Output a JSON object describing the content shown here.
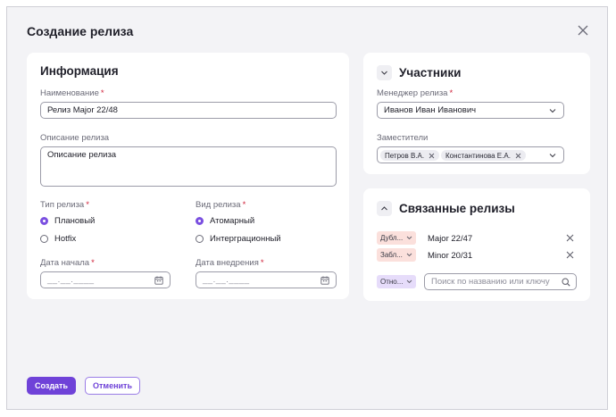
{
  "dialog": {
    "title": "Создание релиза"
  },
  "info": {
    "title": "Информация",
    "name_label": "Наименование",
    "name_value": "Релиз Major 22/48",
    "description_label": "Описание релиза",
    "description_value": "Описание релиза",
    "type_label": "Тип релиза",
    "type_options": [
      "Плановый",
      "Hotfix"
    ],
    "type_selected": "Плановый",
    "kind_label": "Вид релиза",
    "kind_options": [
      "Атомарный",
      "Интерграционный"
    ],
    "kind_selected": "Атомарный",
    "start_label": "Дата начала",
    "start_placeholder": "__.__.____",
    "deploy_label": "Дата внедрения",
    "deploy_placeholder": "__.__.____"
  },
  "participants": {
    "title": "Участники",
    "manager_label": "Менеджер релиза",
    "manager_value": "Иванов Иван Иванович",
    "deputies_label": "Заместители",
    "deputies": [
      "Петров В.А.",
      "Константинова Е.А."
    ]
  },
  "linked": {
    "title": "Связанные релизы",
    "items": [
      {
        "tag": "Дубл...",
        "name": "Major 22/47"
      },
      {
        "tag": "Забл...",
        "name": "Minor 20/31"
      }
    ],
    "new_tag": "Отно...",
    "search_placeholder": "Поиск по названию или ключу"
  },
  "actions": {
    "create_label": "Создать",
    "cancel_label": "Отменить"
  },
  "colors": {
    "accent": "#6f42d8",
    "required": "#d0243c",
    "tag_red": "#fbe0dc",
    "tag_violet": "#e6dcfa"
  }
}
